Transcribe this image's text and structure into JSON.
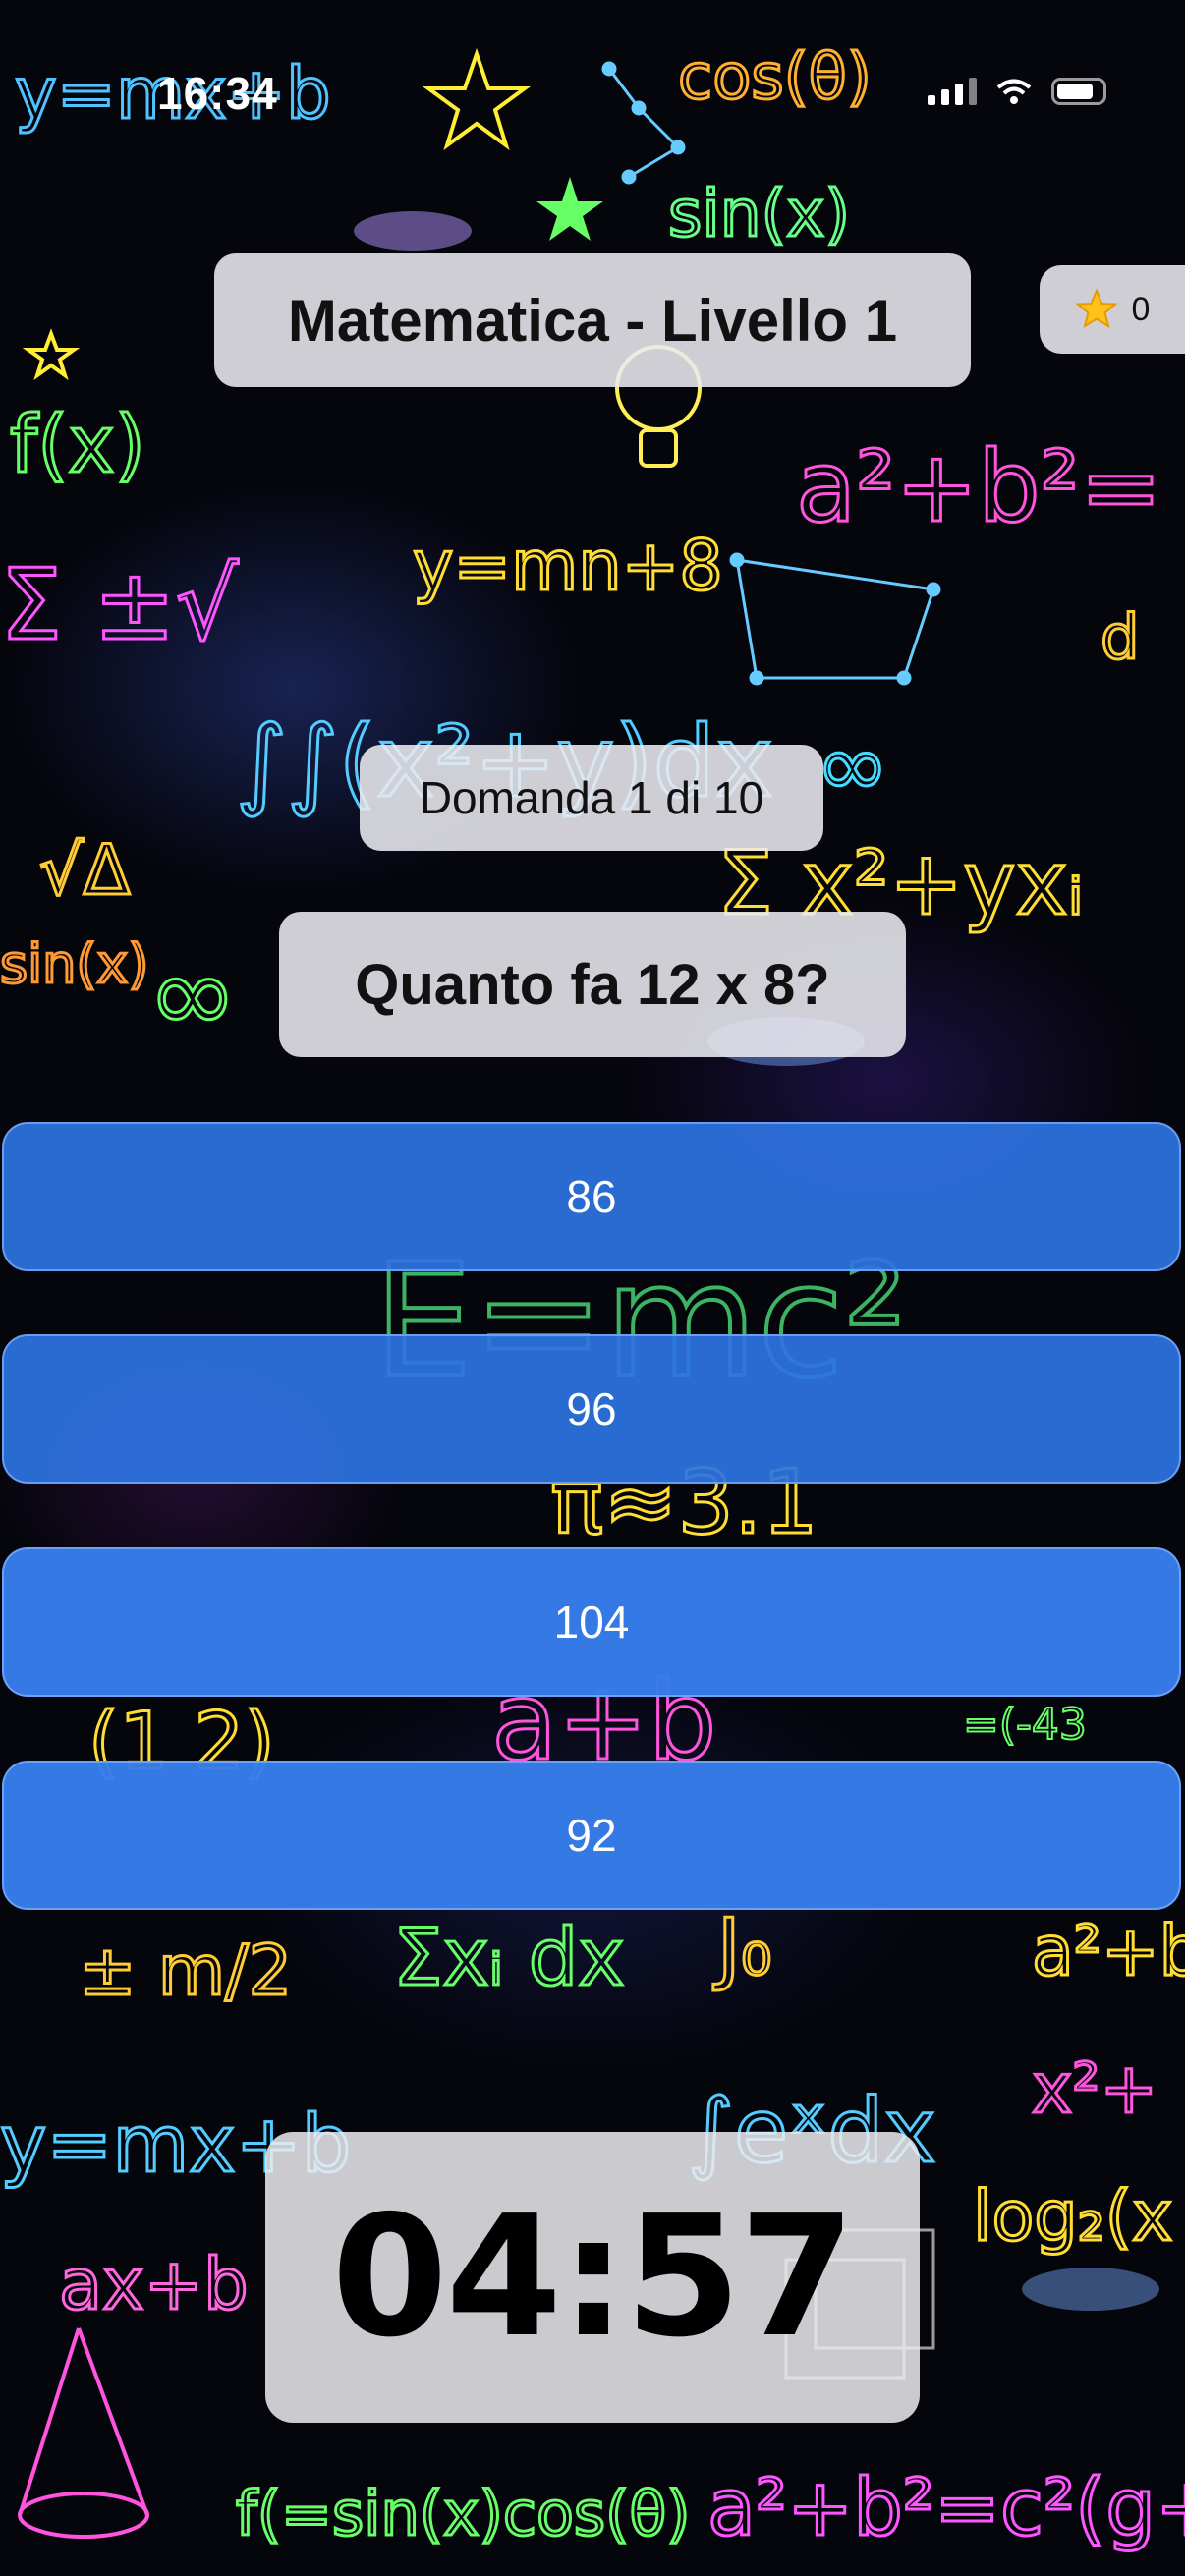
{
  "status_bar": {
    "time": "16:34"
  },
  "header": {
    "title": "Matematica - Livello 1",
    "score_icon": "star-icon",
    "score": "0"
  },
  "quiz": {
    "counter": "Domanda 1 di 10",
    "question": "Quanto fa 12 x 8?",
    "answers": [
      "86",
      "96",
      "104",
      "92"
    ]
  },
  "timer": {
    "value": "04:57"
  },
  "colors": {
    "answer_button": "#2d73e1",
    "panel": "#ebebf0",
    "background": "#05050c"
  }
}
